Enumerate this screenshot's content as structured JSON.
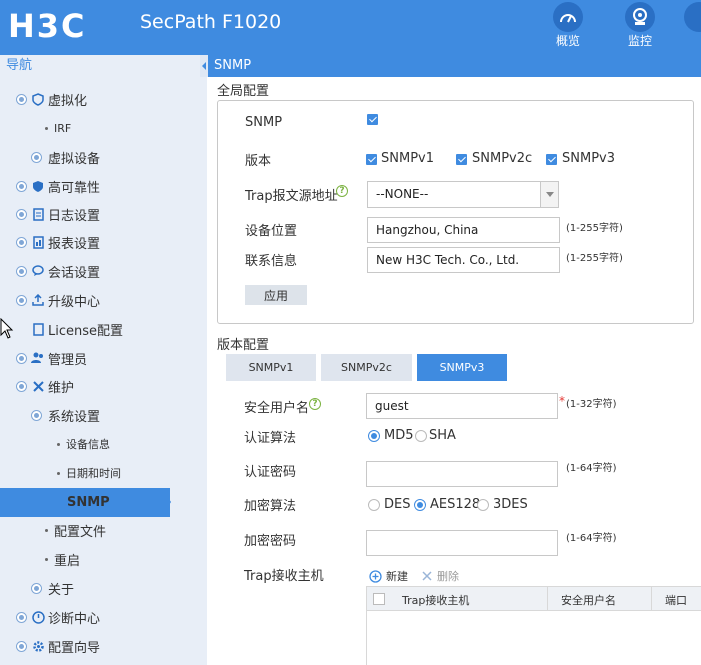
{
  "header": {
    "logo": "H3C",
    "product": "SecPath F1020",
    "nav": [
      {
        "label": "概览",
        "icon": "gauge-icon"
      },
      {
        "label": "监控",
        "icon": "camera-icon"
      }
    ]
  },
  "sidebar": {
    "title": "导航",
    "items": [
      {
        "label": "虚拟化"
      },
      {
        "label": "IRF"
      },
      {
        "label": "虚拟设备"
      },
      {
        "label": "高可靠性"
      },
      {
        "label": "日志设置"
      },
      {
        "label": "报表设置"
      },
      {
        "label": "会话设置"
      },
      {
        "label": "升级中心"
      },
      {
        "label": "License配置"
      },
      {
        "label": "管理员"
      },
      {
        "label": "维护"
      },
      {
        "label": "系统设置"
      },
      {
        "label": "设备信息"
      },
      {
        "label": "日期和时间"
      },
      {
        "label": "SNMP"
      },
      {
        "label": "配置文件"
      },
      {
        "label": "重启"
      },
      {
        "label": "关于"
      },
      {
        "label": "诊断中心"
      },
      {
        "label": "配置向导"
      }
    ]
  },
  "tab": {
    "title": "SNMP"
  },
  "global": {
    "section": "全局配置",
    "snmp_label": "SNMP",
    "snmp_enabled": true,
    "version_label": "版本",
    "versions": [
      "SNMPv1",
      "SNMPv2c",
      "SNMPv3"
    ],
    "trap_label": "Trap报文源地址",
    "trap_value": "--NONE--",
    "location_label": "设备位置",
    "location_value": "Hangzhou, China",
    "location_hint": "(1-255字符)",
    "contact_label": "联系信息",
    "contact_value": "New H3C Tech. Co., Ltd.",
    "contact_hint": "(1-255字符)",
    "apply": "应用"
  },
  "version_cfg": {
    "section": "版本配置",
    "tabs": [
      "SNMPv1",
      "SNMPv2c",
      "SNMPv3"
    ],
    "user_label": "安全用户名",
    "user_value": "guest",
    "user_hint": "(1-32字符)",
    "auth_label": "认证算法",
    "auth_options": [
      "MD5",
      "SHA"
    ],
    "auth_pwd_label": "认证密码",
    "auth_pwd_hint": "(1-64字符)",
    "enc_label": "加密算法",
    "enc_options": [
      "DES",
      "AES128",
      "3DES"
    ],
    "enc_pwd_label": "加密密码",
    "enc_pwd_hint": "(1-64字符)",
    "trap_host_label": "Trap接收主机",
    "new_btn": "新建",
    "delete_btn": "删除",
    "columns": [
      "Trap接收主机",
      "安全用户名",
      "端口"
    ]
  },
  "colors": {
    "accent": "#3f8be0",
    "sidebar_bg": "#e8eef7"
  }
}
